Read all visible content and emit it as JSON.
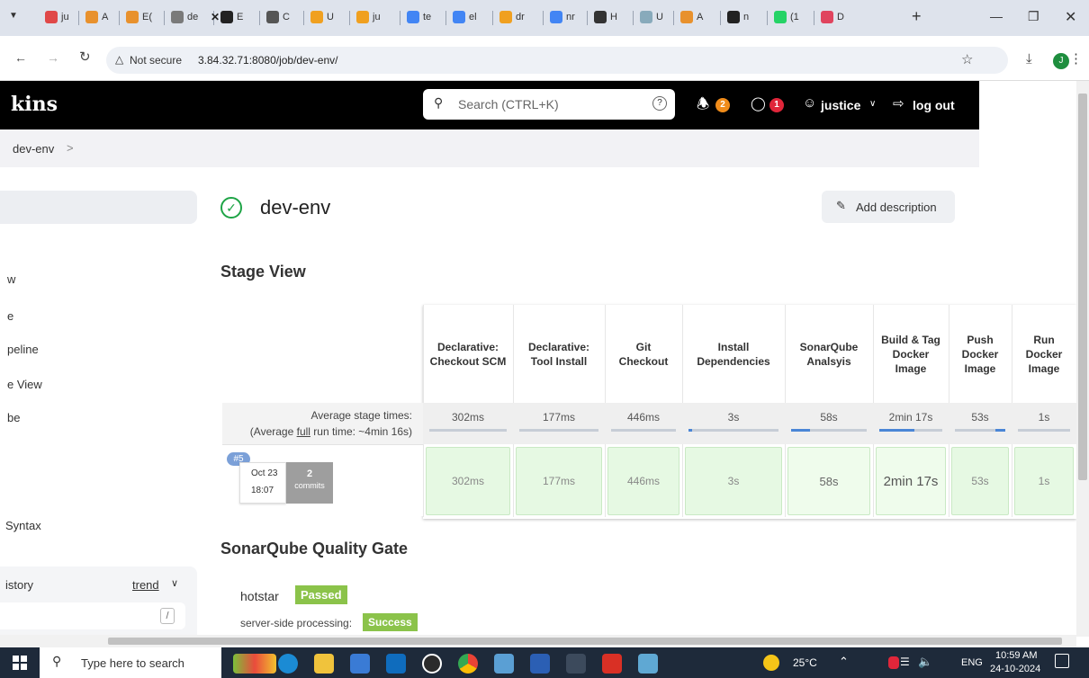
{
  "browser": {
    "tabs": [
      {
        "label": "ju",
        "color": "#e04848"
      },
      {
        "label": "A",
        "color": "#e8912d"
      },
      {
        "label": "E(",
        "color": "#e8912d"
      },
      {
        "label": "de",
        "color": "#7a7a7a"
      },
      {
        "label": "E",
        "color": "#222"
      },
      {
        "label": "C",
        "color": "#555"
      },
      {
        "label": "U",
        "color": "#f0a020"
      },
      {
        "label": "ju",
        "color": "#f0a020"
      },
      {
        "label": "te",
        "color": "#4285f4"
      },
      {
        "label": "el",
        "color": "#4285f4"
      },
      {
        "label": "dr",
        "color": "#f0a020"
      },
      {
        "label": "nr",
        "color": "#4285f4"
      },
      {
        "label": "H",
        "color": "#333"
      },
      {
        "label": "U",
        "color": "#8ab"
      },
      {
        "label": "A",
        "color": "#e8912d"
      },
      {
        "label": "n",
        "color": "#222"
      },
      {
        "label": "(1",
        "color": "#25d366"
      },
      {
        "label": "D",
        "color": "#e0445e"
      }
    ],
    "new_tab": "+",
    "security_label": "Not secure",
    "url": "3.84.32.71:8080/job/dev-env/",
    "profile_initial": "J"
  },
  "header": {
    "brand": "kins",
    "search_placeholder": "Search (CTRL+K)",
    "notifications_count": "2",
    "security_count": "1",
    "user": "justice",
    "logout": "log out"
  },
  "breadcrumb": {
    "item": "dev-env",
    "sep": ">"
  },
  "sidebar": {
    "items": [
      "w",
      "e",
      "peline",
      "e View",
      "be",
      "Syntax"
    ],
    "history_label": "istory",
    "trend_label": "trend",
    "filter_shortcut": "/"
  },
  "main": {
    "title": "dev-env",
    "add_description": "Add description",
    "stage_view_title": "Stage View",
    "avg_label": "Average stage times:",
    "avg_full_prefix": "(Average ",
    "avg_full_link": "full",
    "avg_full_suffix": " run time: ~4min 16s)",
    "stages": [
      {
        "name": "Declarative: Checkout SCM",
        "avg": "302ms",
        "run": "302ms",
        "bar_fill": 0.0
      },
      {
        "name": "Declarative: Tool Install",
        "avg": "177ms",
        "run": "177ms",
        "bar_fill": 0.0
      },
      {
        "name": "Git Checkout",
        "avg": "446ms",
        "run": "446ms",
        "bar_fill": 0.0
      },
      {
        "name": "Install Dependencies",
        "avg": "3s",
        "run": "3s",
        "bar_fill": 0.02
      },
      {
        "name": "SonarQube Analsyis",
        "avg": "58s",
        "run": "58s",
        "bar_fill": 0.25
      },
      {
        "name": "Build & Tag Docker Image",
        "avg": "2min 17s",
        "run": "2min 17s",
        "bar_fill": 0.55
      },
      {
        "name": "Push Docker Image",
        "avg": "53s",
        "run": "53s",
        "bar_fill": 0.2
      },
      {
        "name": "Run Docker Image",
        "avg": "1s",
        "run": "1s",
        "bar_fill": 0.0
      }
    ],
    "run": {
      "badge": "#5",
      "date": "Oct 23",
      "time": "18:07",
      "commits_count": "2",
      "commits_label": "commits"
    },
    "quality_gate_title": "SonarQube Quality Gate",
    "project": "hotstar",
    "gate_status": "Passed",
    "processing_label": "server-side processing:",
    "processing_status": "Success"
  },
  "taskbar": {
    "search_placeholder": "Type here to search",
    "temperature": "25°C",
    "lang": "ENG",
    "time": "10:59 AM",
    "date": "24-10-2024"
  },
  "colors": {
    "success_green": "#8bc34a",
    "cell_green": "#e6f9e3",
    "jenkins_header": "#000000"
  }
}
